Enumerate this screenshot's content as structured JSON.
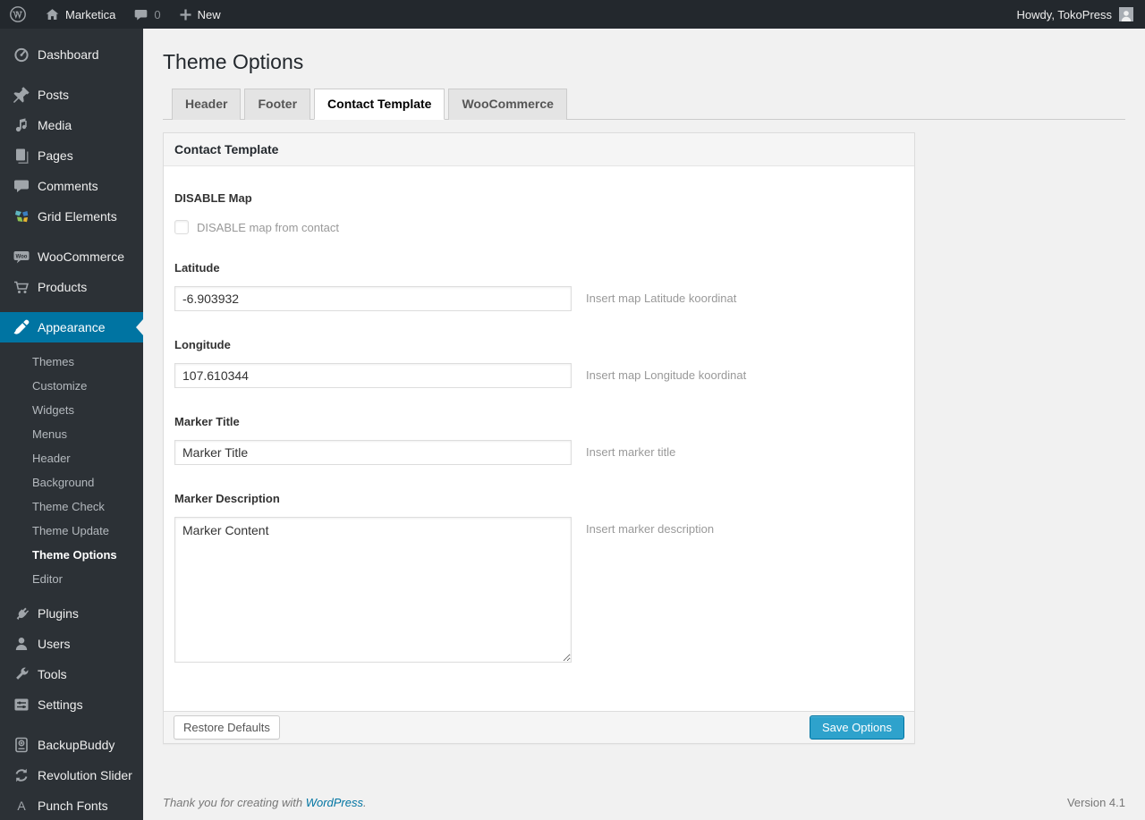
{
  "admin_bar": {
    "site_name": "Marketica",
    "comment_count": "0",
    "new_label": "New",
    "howdy": "Howdy, TokoPress"
  },
  "sidebar": {
    "items": [
      "Dashboard",
      "Posts",
      "Media",
      "Pages",
      "Comments",
      "Grid Elements",
      "WooCommerce",
      "Products",
      "Appearance",
      "Plugins",
      "Users",
      "Tools",
      "Settings",
      "BackupBuddy",
      "Revolution Slider",
      "Punch Fonts"
    ],
    "appearance_submenu": [
      "Themes",
      "Customize",
      "Widgets",
      "Menus",
      "Header",
      "Background",
      "Theme Check",
      "Theme Update",
      "Theme Options",
      "Editor"
    ],
    "active_item": "Appearance",
    "active_submenu_item": "Theme Options"
  },
  "main": {
    "page_title": "Theme Options",
    "tabs": [
      {
        "label": "Header",
        "active": false
      },
      {
        "label": "Footer",
        "active": false
      },
      {
        "label": "Contact Template",
        "active": true
      },
      {
        "label": "WooCommerce",
        "active": false
      }
    ],
    "panel": {
      "title": "Contact Template",
      "sections": {
        "disable_map": {
          "label": "DISABLE Map",
          "checkbox_label": "DISABLE map from contact",
          "checked": false
        },
        "latitude": {
          "label": "Latitude",
          "value": "-6.903932",
          "hint": "Insert map Latitude koordinat"
        },
        "longitude": {
          "label": "Longitude",
          "value": "107.610344",
          "hint": "Insert map Longitude koordinat"
        },
        "marker_title": {
          "label": "Marker Title",
          "value": "Marker Title",
          "hint": "Insert marker title"
        },
        "marker_description": {
          "label": "Marker Description",
          "value": "Marker Content",
          "hint": "Insert marker description"
        }
      },
      "restore_button": "Restore Defaults",
      "save_button": "Save Options"
    }
  },
  "footer": {
    "thanks_prefix": "Thank you for creating with ",
    "wordpress_link": "WordPress",
    "thanks_suffix": ".",
    "version": "Version 4.1"
  },
  "colors": {
    "accent": "#0074a2",
    "primary_button": "#2ea2cc",
    "admin_bar_bg": "#23282d",
    "sidebar_bg": "#2c3136",
    "content_bg": "#f1f1f1"
  }
}
